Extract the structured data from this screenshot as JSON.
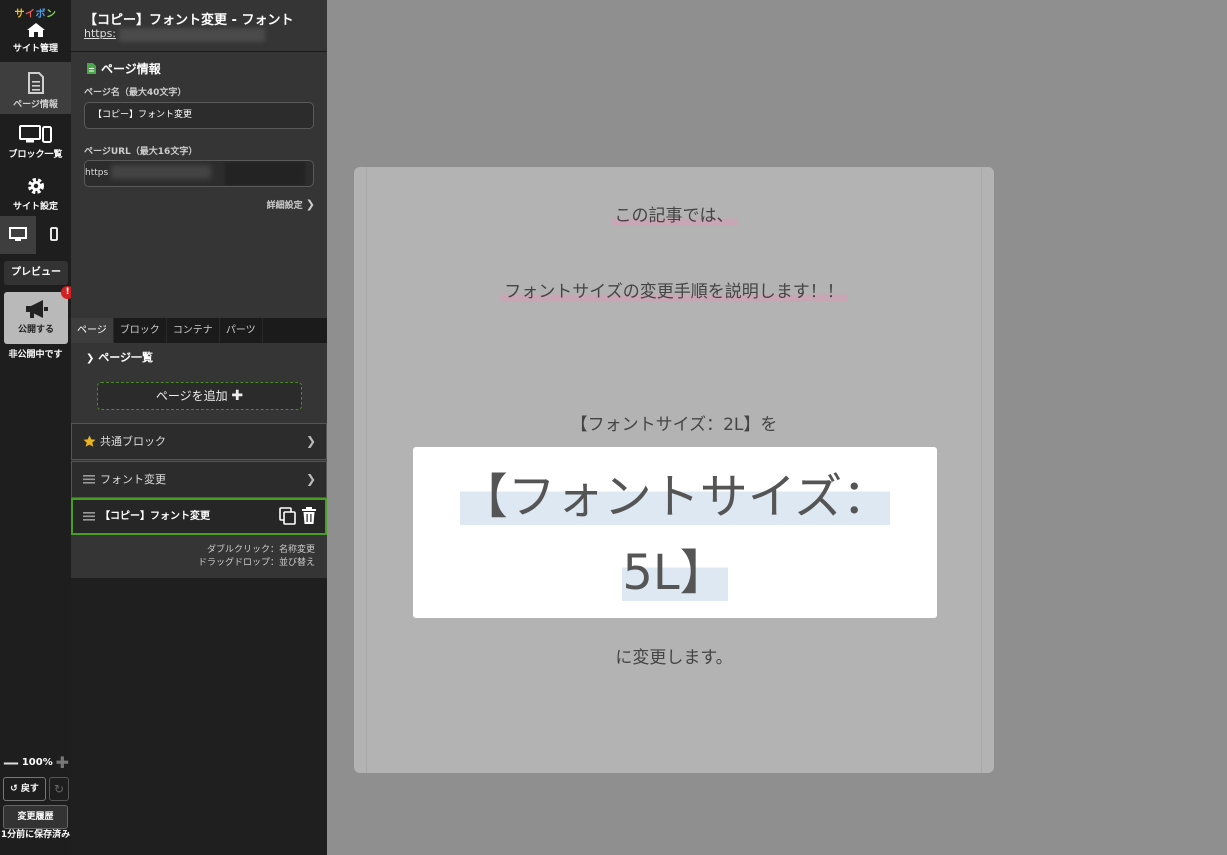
{
  "rail": {
    "logo": [
      "サ",
      "イ",
      "ボ",
      "ン"
    ],
    "items": [
      {
        "label": "サイト管理",
        "icon": "home-icon"
      },
      {
        "label": "ページ情報",
        "icon": "page-info-icon"
      },
      {
        "label": "ブロック一覧",
        "icon": "devices-icon"
      },
      {
        "label": "サイト設定",
        "icon": "gear-icon"
      }
    ],
    "preview_label": "プレビュー",
    "publish_label": "公開する",
    "notify_badge": "!",
    "status": "非公開中です",
    "zoom": "100%",
    "undo_label": "戻す",
    "history_label": "変更履歴",
    "saved_status": "1分前に保存済み"
  },
  "sidebar": {
    "page_heading": "【コピー】フォント変更 - フォント",
    "page_url": "https:",
    "section_title": "ページ情報",
    "name_label": "ページ名（最大40文字）",
    "name_value": "【コピー】フォント変更",
    "url_label": "ページURL（最大16文字）",
    "url_prefix": "https",
    "detail_link": "詳細設定",
    "tabs": [
      "ページ",
      "ブロック",
      "コンテナ",
      "パーツ"
    ],
    "list_title": "ページ一覧",
    "add_button": "ページを追加",
    "pages": [
      {
        "label": "共通ブロック",
        "icon": "star-icon"
      },
      {
        "label": "フォント変更",
        "icon": "drag-handle-icon"
      },
      {
        "label": "【コピー】フォント変更",
        "icon": "drag-handle-icon"
      }
    ],
    "hint_1": "ダブルクリック：名称変更",
    "hint_2": "ドラッグドロップ：並び替え"
  },
  "content": {
    "line_1": "この記事では、",
    "line_2": "フォントサイズの変更手順を説明します！！",
    "line_3": "【フォントサイズ：2L】を",
    "big_1": "【フォントサイズ：",
    "big_2": "5L】",
    "line_4": "に変更します。"
  },
  "colors": {
    "accent_green": "#47a023",
    "badge_red": "#d42020",
    "highlight_pink": "#c9a6b3",
    "highlight_blue": "#dde8f3"
  }
}
